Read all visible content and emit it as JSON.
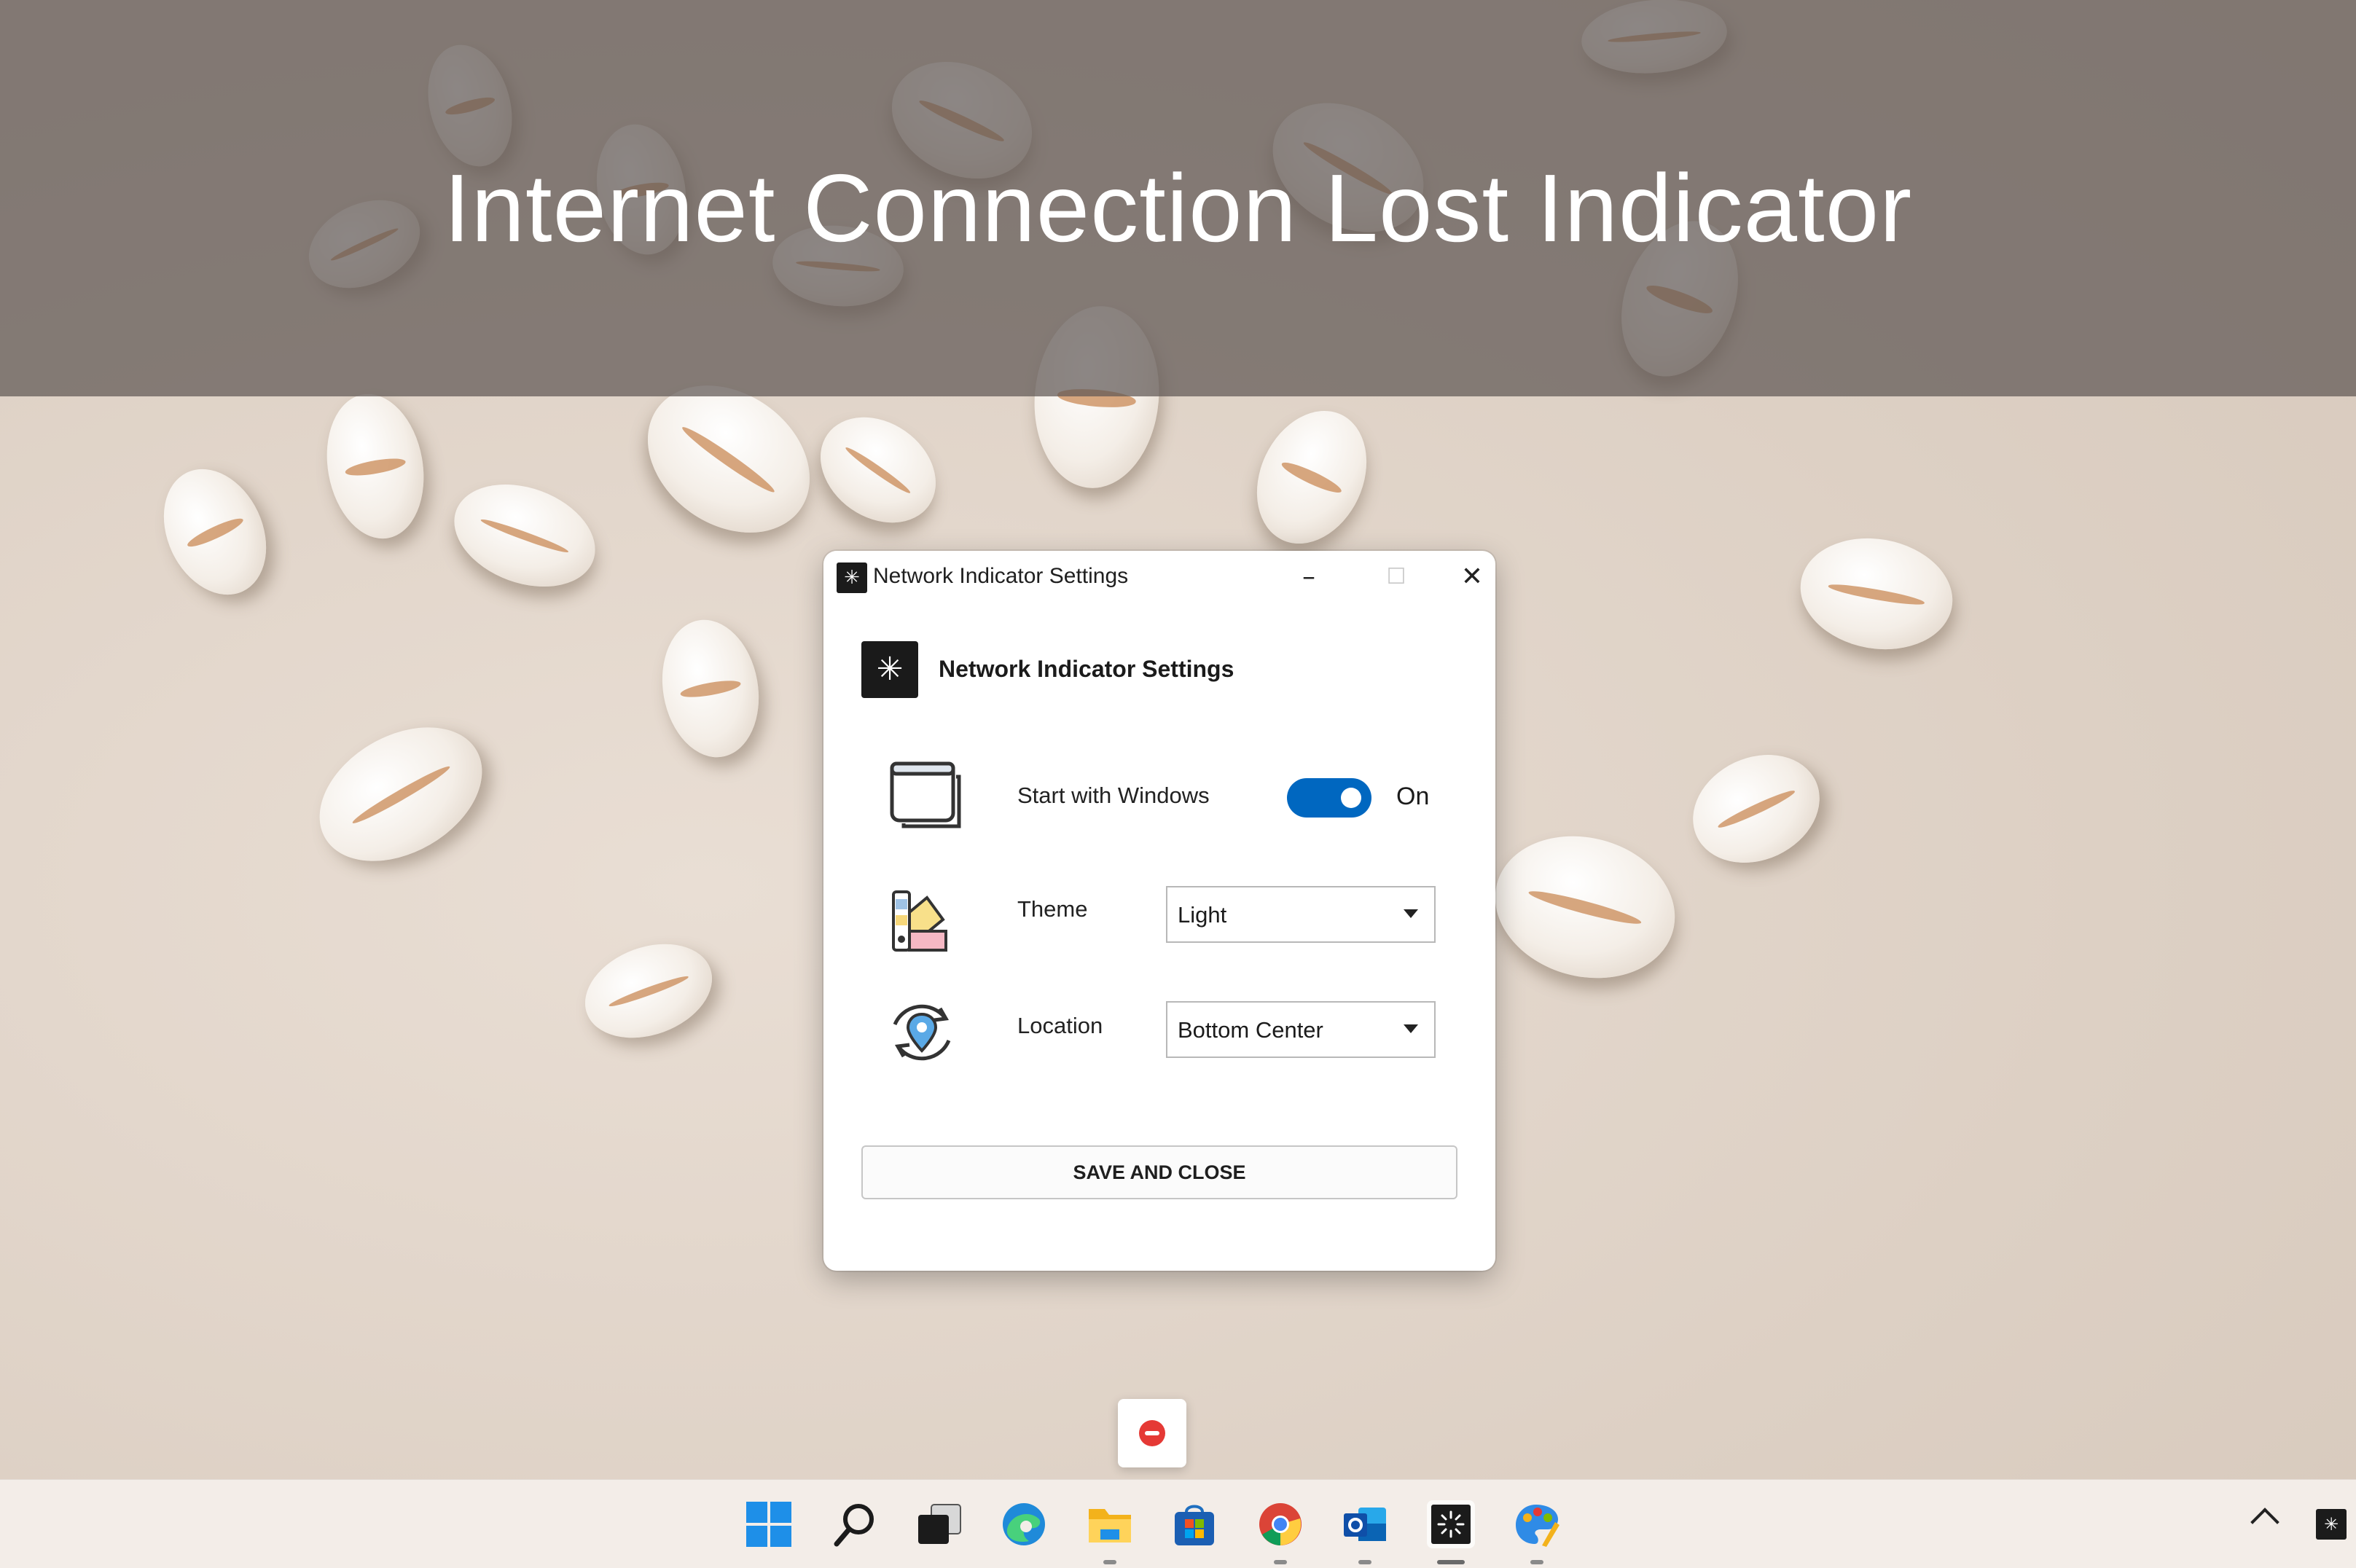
{
  "banner": {
    "title": "Internet Connection Lost Indicator"
  },
  "window": {
    "title": "Network Indicator Settings",
    "header_title": "Network Indicator Settings",
    "controls": {
      "minimize": "–",
      "maximize": "☐",
      "close": "✕"
    }
  },
  "settings": {
    "start_with_windows": {
      "label": "Start with Windows",
      "state": "On",
      "enabled": true
    },
    "theme": {
      "label": "Theme",
      "value": "Light"
    },
    "location": {
      "label": "Location",
      "value": "Bottom Center"
    },
    "save_label": "SAVE AND CLOSE"
  },
  "taskbar": {
    "icons": [
      "windows-start-icon",
      "search-icon",
      "task-view-icon",
      "edge-icon",
      "file-explorer-icon",
      "microsoft-store-icon",
      "chrome-icon",
      "outlook-icon",
      "network-indicator-icon",
      "paint-icon"
    ]
  },
  "colors": {
    "accent": "#0067c0",
    "alert": "#e53935"
  }
}
